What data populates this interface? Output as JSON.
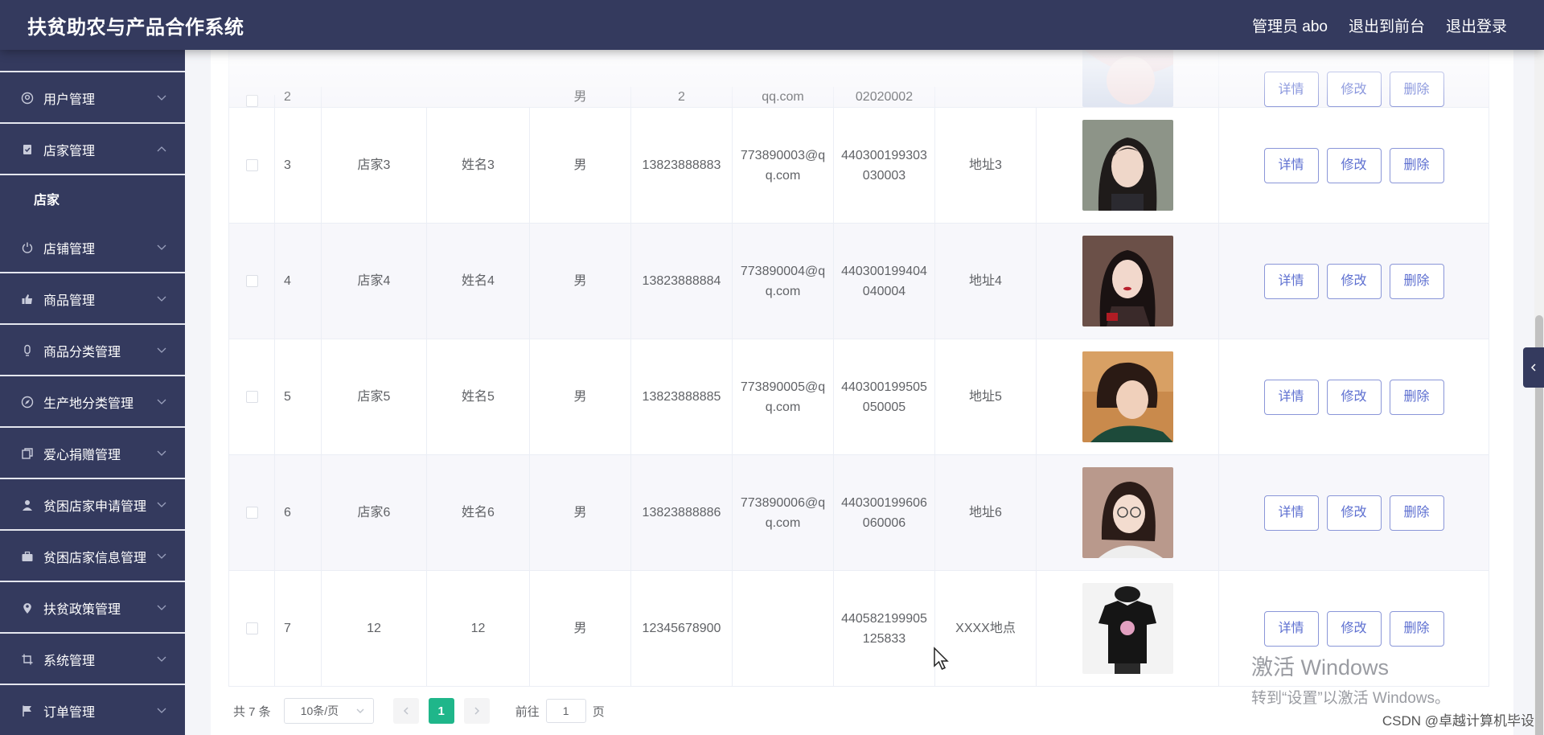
{
  "app": {
    "title": "扶贫助农与产品合作系统"
  },
  "header": {
    "user_label": "管理员 abo",
    "to_front": "退出到前台",
    "logout": "退出登录"
  },
  "sidebar": {
    "items": [
      {
        "label": "用户管理",
        "icon": "user-circle-icon"
      },
      {
        "label": "店家管理",
        "icon": "clipboard-icon",
        "expanded": true
      },
      {
        "label": "店铺管理",
        "icon": "power-icon"
      },
      {
        "label": "商品管理",
        "icon": "thumb-icon"
      },
      {
        "label": "商品分类管理",
        "icon": "bulb-icon"
      },
      {
        "label": "生产地分类管理",
        "icon": "compass-icon"
      },
      {
        "label": "爱心捐赠管理",
        "icon": "copy-icon"
      },
      {
        "label": "贫困店家申请管理",
        "icon": "person-icon"
      },
      {
        "label": "贫困店家信息管理",
        "icon": "briefcase-icon"
      },
      {
        "label": "扶贫政策管理",
        "icon": "location-icon"
      },
      {
        "label": "系统管理",
        "icon": "crop-icon"
      },
      {
        "label": "订单管理",
        "icon": "flag-icon"
      }
    ],
    "submenu": {
      "label": "店家"
    }
  },
  "table": {
    "rows": [
      {
        "index": "2",
        "name": "",
        "person": "",
        "sex": "男",
        "phone": "2",
        "email": "qq.com",
        "id_card": "02020002",
        "address": "",
        "photo": "girl-portrait-2"
      },
      {
        "index": "3",
        "name": "店家3",
        "person": "姓名3",
        "sex": "男",
        "phone": "13823888883",
        "email": "773890003@qq.com",
        "id_card": "440300199303030003",
        "address": "地址3",
        "photo": "girl-portrait-3"
      },
      {
        "index": "4",
        "name": "店家4",
        "person": "姓名4",
        "sex": "男",
        "phone": "13823888884",
        "email": "773890004@qq.com",
        "id_card": "440300199404040004",
        "address": "地址4",
        "photo": "girl-portrait-4"
      },
      {
        "index": "5",
        "name": "店家5",
        "person": "姓名5",
        "sex": "男",
        "phone": "13823888885",
        "email": "773890005@qq.com",
        "id_card": "440300199505050005",
        "address": "地址5",
        "photo": "girl-portrait-5"
      },
      {
        "index": "6",
        "name": "店家6",
        "person": "姓名6",
        "sex": "男",
        "phone": "13823888886",
        "email": "773890006@qq.com",
        "id_card": "440300199606060006",
        "address": "地址6",
        "photo": "girl-portrait-6"
      },
      {
        "index": "7",
        "name": "12",
        "person": "12",
        "sex": "男",
        "phone": "12345678900",
        "email": "",
        "id_card": "440582199905125833",
        "address": "XXXX地点",
        "photo": "tshirt-photo"
      }
    ],
    "actions": {
      "detail": "详情",
      "edit": "修改",
      "delete": "删除"
    }
  },
  "pagination": {
    "total": "共 7 条",
    "page_size": "10条/页",
    "current_page": "1",
    "goto_label": "前往",
    "goto_value": "1",
    "page_unit": "页"
  },
  "watermark": {
    "line1": "激活 Windows",
    "line2": "转到“设置”以激活 Windows。"
  },
  "csdn": "CSDN @卓越计算机毕设",
  "colors": {
    "sidebar": "#343a5e",
    "accent": "#1fb68a",
    "button_border": "#8a96d8"
  }
}
